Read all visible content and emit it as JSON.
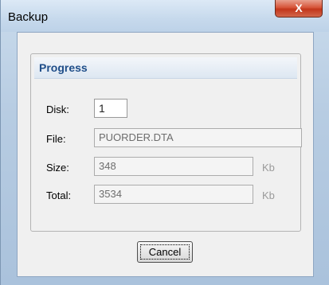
{
  "window": {
    "title": "Backup",
    "close_label": "X"
  },
  "progress": {
    "title": "Progress",
    "disk": {
      "label": "Disk:",
      "value": "1"
    },
    "file": {
      "label": "File:",
      "value": "PUORDER.DTA"
    },
    "size": {
      "label": "Size:",
      "value": "348",
      "unit": "Kb"
    },
    "total": {
      "label": "Total:",
      "value": "3534",
      "unit": "Kb"
    }
  },
  "buttons": {
    "cancel_label": "Cancel"
  }
}
